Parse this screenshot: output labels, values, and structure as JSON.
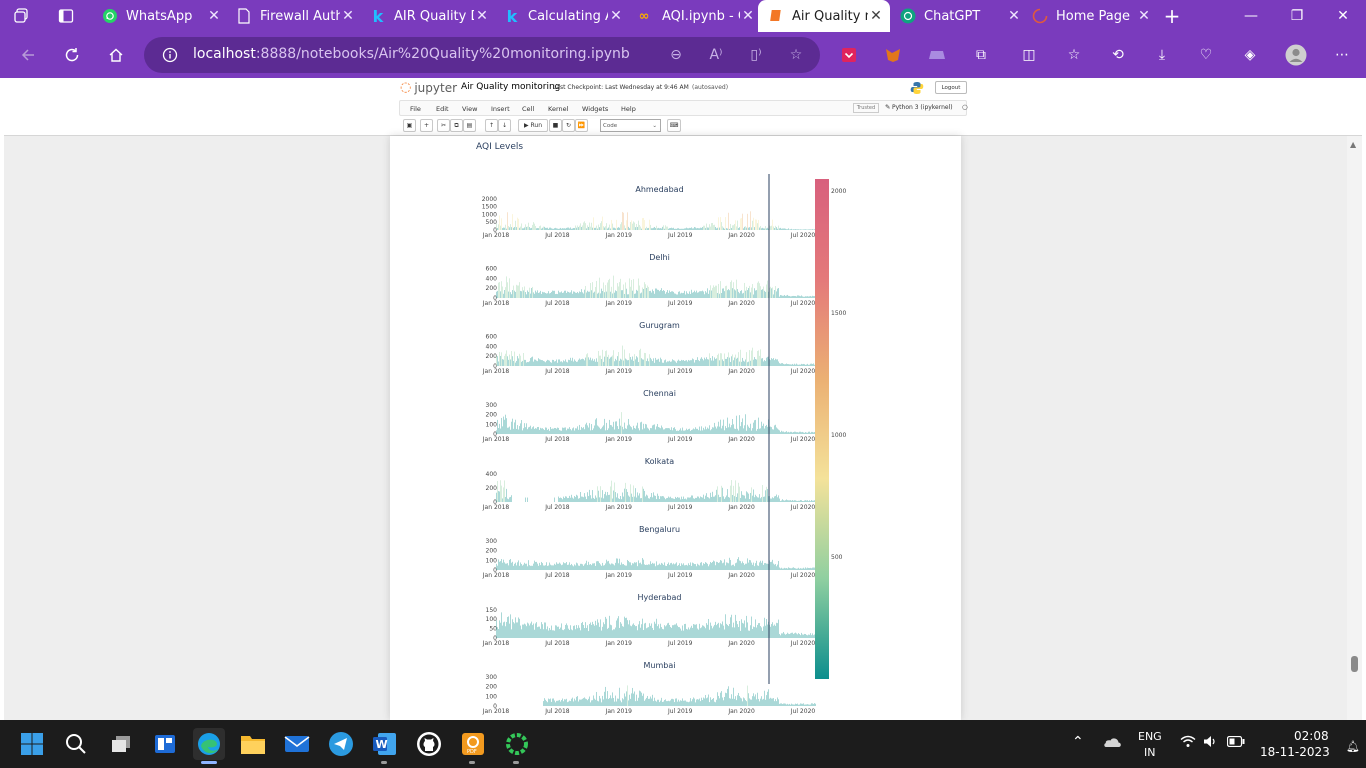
{
  "browser": {
    "tabs": [
      {
        "label": "",
        "icon": "workspaces-icon"
      },
      {
        "label": "",
        "icon": "tab-actions-icon"
      },
      {
        "label": "WhatsApp",
        "icon": "whatsapp-icon"
      },
      {
        "label": "Firewall Auth",
        "icon": "page-icon"
      },
      {
        "label": "AIR Quality D",
        "icon": "kaggle-icon"
      },
      {
        "label": "Calculating A",
        "icon": "kaggle-icon"
      },
      {
        "label": "AQI.ipynb - C",
        "icon": "colab-icon"
      },
      {
        "label": "Air Quality m",
        "icon": "jupyter-icon"
      },
      {
        "label": "ChatGPT",
        "icon": "chatgpt-icon"
      },
      {
        "label": "Home Page",
        "icon": "loading-icon"
      }
    ],
    "url_host": "localhost",
    "url_path": ":8888/notebooks/Air%20Quality%20monitoring.ipynb"
  },
  "jupyter": {
    "logo_text": "jupyter",
    "notebook_title": "Air Quality monitoring",
    "checkpoint": "Last Checkpoint: Last Wednesday at 9:46 AM",
    "autosaved": "(autosaved)",
    "logout_label": "Logout",
    "menu": [
      "File",
      "Edit",
      "View",
      "Insert",
      "Cell",
      "Kernel",
      "Widgets",
      "Help"
    ],
    "trusted_label": "Trusted",
    "kernel_label": "Python 3 (ipykernel)",
    "run_label": "Run",
    "cell_type": "Code"
  },
  "chart_data": {
    "type": "area",
    "title": "AQI Levels",
    "x_tick_labels": [
      "Jan 2018",
      "Jul 2018",
      "Jan 2019",
      "Jul 2019",
      "Jan 2020",
      "Jul 2020"
    ],
    "vertical_marker": "Mar 2020",
    "colorbar": {
      "ticks": [
        500,
        1000,
        1500,
        2000
      ],
      "range": [
        0,
        2050
      ],
      "colors": [
        "#0c8e8d",
        "#8fcfa0",
        "#f4e29a",
        "#ebb073",
        "#e4797a",
        "#d8607d"
      ]
    },
    "subplots": [
      {
        "name": "Ahmedabad",
        "y_ticks": [
          0,
          500,
          1000,
          1500,
          2000
        ],
        "ylim": [
          0,
          2050
        ],
        "typical": [
          150,
          1300
        ]
      },
      {
        "name": "Delhi",
        "y_ticks": [
          0,
          200,
          400,
          600
        ],
        "ylim": [
          0,
          650
        ],
        "typical": [
          150,
          500
        ]
      },
      {
        "name": "Gurugram",
        "y_ticks": [
          0,
          200,
          400,
          600
        ],
        "ylim": [
          0,
          650
        ],
        "typical": [
          140,
          450
        ]
      },
      {
        "name": "Chennai",
        "y_ticks": [
          0,
          100,
          200,
          300
        ],
        "ylim": [
          0,
          330
        ],
        "typical": [
          70,
          230
        ]
      },
      {
        "name": "Kolkata",
        "y_ticks": [
          0,
          200,
          400
        ],
        "ylim": [
          0,
          460
        ],
        "typical": [
          80,
          350
        ]
      },
      {
        "name": "Bengaluru",
        "y_ticks": [
          0,
          100,
          200,
          300
        ],
        "ylim": [
          0,
          330
        ],
        "typical": [
          80,
          150
        ]
      },
      {
        "name": "Hyderabad",
        "y_ticks": [
          0,
          50,
          100,
          150
        ],
        "ylim": [
          0,
          170
        ],
        "typical": [
          80,
          150
        ]
      },
      {
        "name": "Mumbai",
        "y_ticks": [
          0,
          100,
          200,
          300
        ],
        "ylim": [
          0,
          330
        ],
        "typical": [
          80,
          240
        ]
      }
    ]
  },
  "taskbar": {
    "apps": [
      "start-icon",
      "search-icon",
      "task-view-icon",
      "news-icon",
      "edge-icon",
      "file-explorer-icon",
      "mail-icon",
      "telegram-icon",
      "word-icon",
      "github-icon",
      "pdf-icon",
      "ring-app-icon"
    ],
    "language": "ENG",
    "region": "IN",
    "time": "02:08",
    "date": "18-11-2023"
  }
}
